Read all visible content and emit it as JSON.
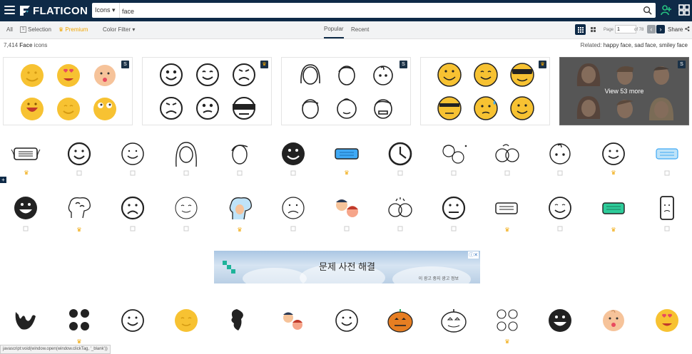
{
  "header": {
    "brand": "FLATICON",
    "search_type": "Icons",
    "search_query": "face"
  },
  "subnav": {
    "all": "All",
    "selection": "Selection",
    "premium": "Premium",
    "color_filter": "Color Filter",
    "tab_popular": "Popular",
    "tab_recent": "Recent",
    "page_label": "Page",
    "page_value": "1",
    "page_of": "of 78",
    "share": "Share"
  },
  "results": {
    "count": "7,414",
    "term": "Face",
    "suffix": "icons",
    "related_label": "Related:",
    "related": "happy face, sad face, smiley face"
  },
  "packs": [
    {
      "badge": "S"
    },
    {
      "badge": "crown"
    },
    {
      "badge": "S"
    },
    {
      "badge": "crown"
    },
    {
      "badge": "S",
      "overlay": "View 53 more"
    }
  ],
  "ad": {
    "text": "문제 사전 해결",
    "small": "이 광고 중지  광고 정보"
  },
  "status_bar": "javascript:void(window.open(window.clickTag, '_blank'))",
  "colors": {
    "navy": "#0e2a47",
    "yellow": "#f7c232",
    "premium": "#f0a500"
  }
}
